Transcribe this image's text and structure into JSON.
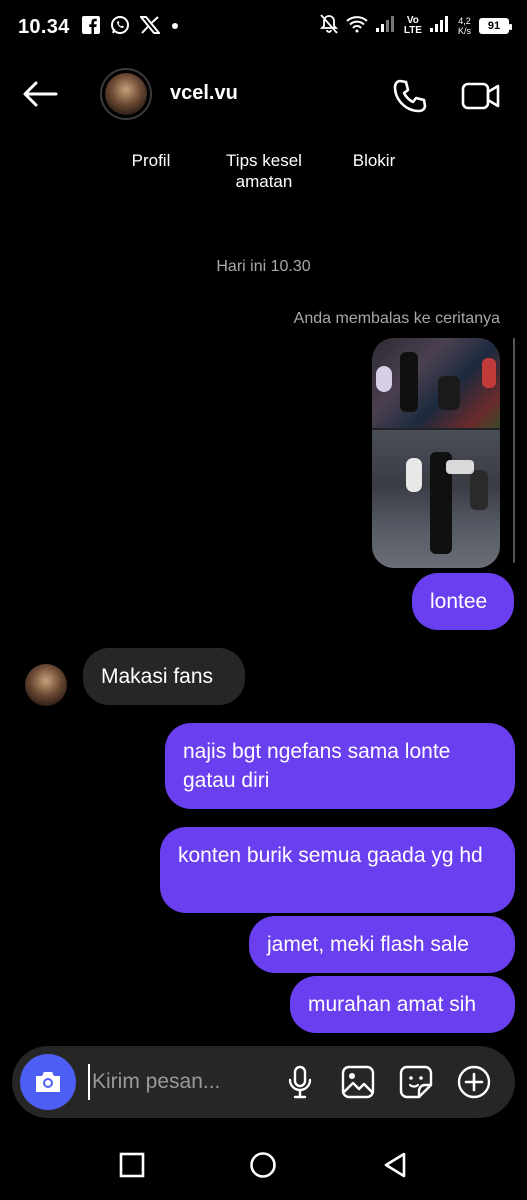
{
  "status_bar": {
    "time": "10.34",
    "volte_top": "Vo",
    "volte_bottom": "LTE",
    "speed_value": "4,2",
    "speed_unit": "K/s",
    "battery": "91"
  },
  "header": {
    "username": "vcel.vu"
  },
  "profile_links": {
    "profil": "Profil",
    "tips_line1": "Tips kesel",
    "tips_line2": "amatan",
    "blokir": "Blokir"
  },
  "chat": {
    "date_separator": "Hari ini 10.30",
    "reply_note": "Anda membalas ke ceritanya",
    "messages": [
      {
        "sender": "me",
        "text": "lontee"
      },
      {
        "sender": "them",
        "text": "Makasi fans"
      },
      {
        "sender": "me",
        "text": "najis bgt ngefans sama lonte gatau diri"
      },
      {
        "sender": "me",
        "text": "konten burik semua gaada yg hd"
      },
      {
        "sender": "me",
        "text": "jamet, meki flash sale"
      },
      {
        "sender": "me",
        "text": "murahan amat sih"
      }
    ]
  },
  "composer": {
    "placeholder": "Kirim pesan..."
  },
  "icons": {
    "back": "back-arrow-icon",
    "call": "phone-icon",
    "video": "video-camera-icon",
    "camera": "camera-icon",
    "mic": "microphone-icon",
    "gallery": "image-icon",
    "sticker": "sticker-icon",
    "add": "plus-circle-icon"
  },
  "colors": {
    "my_bubble": "#6a3ff0",
    "their_bubble": "#262626",
    "camera_button": "#4d5ef5",
    "background": "#000000"
  }
}
